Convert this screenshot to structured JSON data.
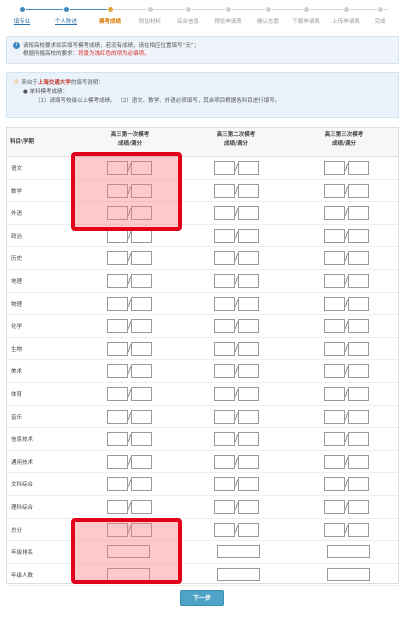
{
  "steps": [
    {
      "label": "填专业",
      "state": "done"
    },
    {
      "label": "个人陈述",
      "state": "done"
    },
    {
      "label": "模考成绩",
      "state": "current"
    },
    {
      "label": "附加材料",
      "state": "todo"
    },
    {
      "label": "综合信息",
      "state": "todo"
    },
    {
      "label": "预览申请表",
      "state": "todo"
    },
    {
      "label": "确认志愿",
      "state": "todo"
    },
    {
      "label": "下载申请表",
      "state": "todo"
    },
    {
      "label": "上传申请表",
      "state": "todo"
    },
    {
      "label": "完成",
      "state": "todo"
    }
  ],
  "info": {
    "line1": "请按高校要求如实填写模考成绩，若没有成绩，请在相应位置填写“无”；",
    "line2_prefix": "根据所报高校的要求：",
    "line2_red": "背景为浅红色的项为必填项。"
  },
  "notice": {
    "prefix": "来自于",
    "school": "上海交通大学",
    "suffix": "的填写说明：",
    "bullet": "● 单科模考成绩：",
    "detail": "（1）请填写校级以上模考成绩。   （2）语文、数学、外语必须填写，其余项目根据各科目进行填写。"
  },
  "table": {
    "col0": "科目\\学期",
    "col1_l1": "高三第一次模考",
    "col1_l2": "成绩/满分",
    "col2_l1": "高三第二次模考",
    "col2_l2": "成绩/满分",
    "col3_l1": "高三第三次模考",
    "col3_l2": "成绩/满分",
    "rows": [
      "语文",
      "数学",
      "外语",
      "政治",
      "历史",
      "地理",
      "物理",
      "化学",
      "生物",
      "美术",
      "体育",
      "音乐",
      "信息技术",
      "通用技术",
      "文科综合",
      "理科综合",
      "总分",
      "年级排名",
      "年级人数"
    ]
  },
  "next_button": "下一步",
  "colors": {
    "accent": "#3f89c0",
    "current_step": "#d77b00",
    "required_highlight": "#e3001b",
    "button": "#4fa3c6"
  }
}
